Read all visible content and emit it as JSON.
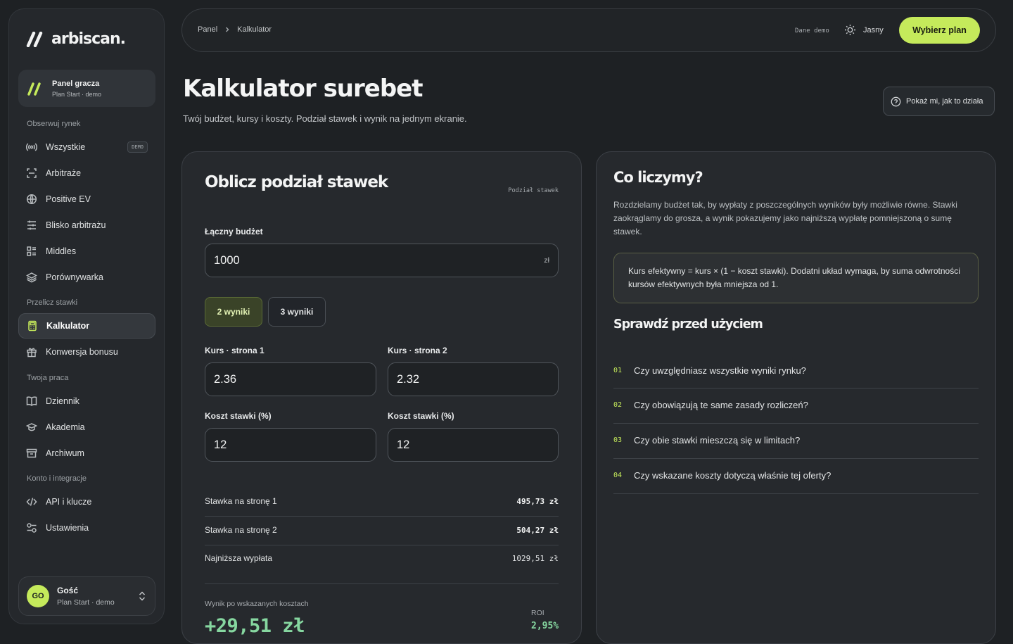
{
  "brand": {
    "name": "arbiscan.",
    "accent": "#c5ea5b"
  },
  "account_card": {
    "title": "Panel gracza",
    "plan": "Plan Start · demo"
  },
  "sidebar": {
    "sections": [
      "Obserwuj rynek",
      "Przelicz stawki",
      "Twoja praca",
      "Konto i integracje"
    ],
    "items": [
      {
        "label": "Wszystkie",
        "icon": "broadcast-icon",
        "badge": "DEMO"
      },
      {
        "label": "Arbitraże",
        "icon": "scan-icon"
      },
      {
        "label": "Positive EV",
        "icon": "globe-icon"
      },
      {
        "label": "Blisko arbitrażu",
        "icon": "sliders-icon"
      },
      {
        "label": "Middles",
        "icon": "list-icon"
      },
      {
        "label": "Porównywarka",
        "icon": "layers-icon"
      },
      {
        "label": "Kalkulator",
        "icon": "calculator-icon",
        "active": true
      },
      {
        "label": "Konwersja bonusu",
        "icon": "gift-icon"
      },
      {
        "label": "Dziennik",
        "icon": "book-icon"
      },
      {
        "label": "Akademia",
        "icon": "graduation-cap-icon"
      },
      {
        "label": "Archiwum",
        "icon": "archive-icon"
      },
      {
        "label": "API i klucze",
        "icon": "code-icon"
      },
      {
        "label": "Ustawienia",
        "icon": "settings-toggle-icon"
      }
    ]
  },
  "user": {
    "initials": "GO",
    "name": "Gość",
    "plan": "Plan Start · demo"
  },
  "topbar": {
    "breadcrumb": [
      "Panel",
      "Kalkulator"
    ],
    "data_label": "Dane demo",
    "theme_label": "Jasny",
    "cta": "Wybierz plan"
  },
  "page": {
    "title": "Kalkulator surebet",
    "subtitle": "Twój budżet, kursy i koszty. Podział stawek i wynik na jednym ekranie.",
    "how_button": "Pokaż mi, jak to działa"
  },
  "calculator": {
    "title": "Oblicz podział stawek",
    "tag": "Podział stawek",
    "budget_label": "Łączny budżet",
    "budget_value": "1000",
    "currency": "zł",
    "outcomes": [
      "2 wyniki",
      "3 wyniki"
    ],
    "selected_outcomes": "2 wyniki",
    "odds_label_1": "Kurs · strona 1",
    "odds_label_2": "Kurs · strona 2",
    "odds_1": "2.36",
    "odds_2": "2.32",
    "cost_label_1": "Koszt stawki (%)",
    "cost_label_2": "Koszt stawki (%)",
    "cost_1": "12",
    "cost_2": "12",
    "results": [
      {
        "label": "Stawka na stronę 1",
        "value": "495,73 zł"
      },
      {
        "label": "Stawka na stronę 2",
        "value": "504,27 zł"
      },
      {
        "label": "Najniższa wypłata",
        "value": "1029,51 zł"
      }
    ],
    "result_label": "Wynik po wskazanych kosztach",
    "result_value": "+29,51 zł",
    "roi_label": "ROI",
    "roi_value": "2,95%"
  },
  "info": {
    "title": "Co liczymy?",
    "text": "Rozdzielamy budżet tak, by wypłaty z poszczególnych wyników były możliwie równe. Stawki zaokrąglamy do grosza, a wynik pokazujemy jako najniższą wypłatę pomniejszoną o sumę stawek.",
    "formula": "Kurs efektywny = kurs × (1 − koszt stawki). Dodatni układ wymaga, by suma odwrotności kursów efektywnych była mniejsza od 1.",
    "check_title": "Sprawdź przed użyciem",
    "checks": [
      {
        "num": "01",
        "text": "Czy uwzględniasz wszystkie wyniki rynku?"
      },
      {
        "num": "02",
        "text": "Czy obowiązują te same zasady rozliczeń?"
      },
      {
        "num": "03",
        "text": "Czy obie stawki mieszczą się w limitach?"
      },
      {
        "num": "04",
        "text": "Czy wskazane koszty dotyczą właśnie tej oferty?"
      }
    ]
  }
}
